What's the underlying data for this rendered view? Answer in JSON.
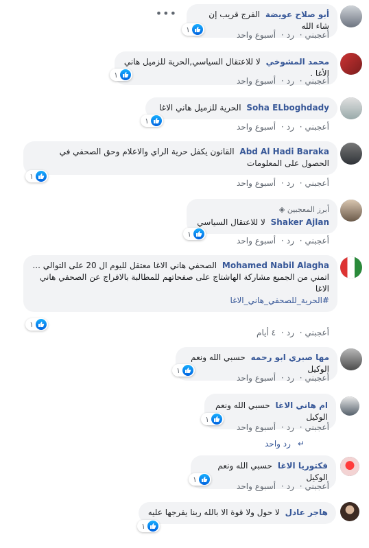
{
  "comments": [
    {
      "author": "أبو صلاح عويضة",
      "text": "الفرج قريب إن شاء الله",
      "likes": "١",
      "like_label": "أعجبني",
      "reply_label": "رد",
      "time": "أسبوع واحد"
    },
    {
      "author": "محمد المشوخي",
      "text": "لا للاعتقال السياسي,الحرية للزميل هاني الأغا .",
      "likes": "١",
      "like_label": "أعجبني",
      "reply_label": "رد",
      "time": "أسبوع واحد"
    },
    {
      "author": "Soha ELboghdady",
      "text": "الحرية للزميل هاني الاغا",
      "likes": "١",
      "like_label": "أعجبني",
      "reply_label": "رد",
      "time": "أسبوع واحد"
    },
    {
      "author": "Abd Al Hadi Baraka",
      "text": "القانون يكفل حرية الراي والاعلام وحق الصحفي في الحصول على المعلومات",
      "likes": "١",
      "like_label": "أعجبني",
      "reply_label": "رد",
      "time": "أسبوع واحد"
    },
    {
      "author": "Shaker Ajlan",
      "fan_label": "أبرز المعجبين",
      "text": "لا للاعتقال السياسي",
      "likes": "١",
      "like_label": "أعجبني",
      "reply_label": "رد",
      "time": "أسبوع واحد"
    },
    {
      "author": "Mohamed Nabil Alagha",
      "text": "الصحفي هاني الاغا معتقل لليوم ال 20 على التوالي ...",
      "text2": "اتمني من الجميع مشاركة الهاشتاج على صفحاتهم للمطالبة بالافراج عن الصحفي هاني الاغا",
      "hashtag": "#الحرية_للصحفي_هاني_الاغا",
      "likes": "١",
      "like_label": "أعجبني",
      "reply_label": "رد",
      "time": "٤ أيام"
    },
    {
      "author": "مها صبري ابو رحمه",
      "text": "حسبي الله ونعم الوكيل",
      "likes": "١",
      "like_label": "أعجبني",
      "reply_label": "رد",
      "time": "أسبوع واحد"
    },
    {
      "author": "ام هاني الاغا",
      "text": "حسبي الله ونعم الوكيل",
      "likes": "١",
      "like_label": "أعجبني",
      "reply_label": "رد",
      "time": "أسبوع واحد"
    },
    {
      "author": "فكتوريا الاغا",
      "text": "حسبي الله ونعم الوكيل",
      "likes": "١",
      "like_label": "أعجبني",
      "reply_label": "رد",
      "time": "أسبوع واحد"
    },
    {
      "author": "هاجر عادل",
      "text": "لا حول ولا قوة الا بالله ربنا يفرجها عليه",
      "likes": "١"
    }
  ],
  "reply_thread": {
    "label": "رد واحد"
  },
  "more_icon": "more-dots-icon",
  "colors": {
    "author": "#385898",
    "bubble": "#f2f3f5",
    "like_blue": "#1877f2",
    "meta": "#606770"
  }
}
